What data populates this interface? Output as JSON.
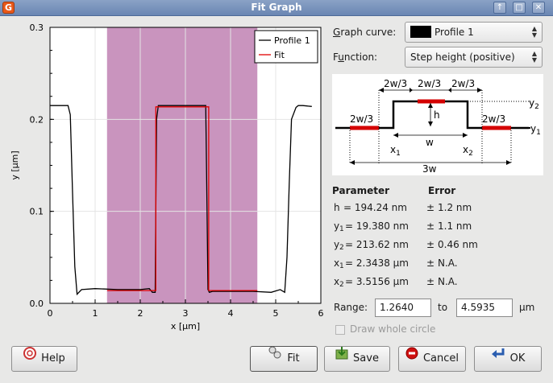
{
  "window": {
    "title": "Fit Graph",
    "app_icon_glyph": "G"
  },
  "window_buttons": {
    "up": "↑",
    "maximize": "□",
    "close": "✕"
  },
  "chart_data": {
    "type": "line",
    "xlabel": "x [µm]",
    "ylabel": "y [µm]",
    "xlim": [
      0,
      6
    ],
    "ylim": [
      0,
      0.3
    ],
    "x_ticks": [
      "0",
      "1",
      "2",
      "3",
      "4",
      "5",
      "6"
    ],
    "y_ticks": [
      "0.0",
      "0.1",
      "0.2",
      "0.3"
    ],
    "highlight_range": [
      1.264,
      4.5935
    ],
    "highlight_color": "#c994be",
    "legend": {
      "position": "top-right",
      "entries": [
        "Profile 1",
        "Fit"
      ]
    },
    "series": [
      {
        "name": "Profile 1",
        "color": "#000000",
        "x": [
          0,
          0.4,
          0.45,
          0.5,
          0.55,
          0.6,
          0.7,
          1.0,
          1.5,
          2.0,
          2.2,
          2.27,
          2.33,
          2.36,
          2.4,
          3.0,
          3.45,
          3.47,
          3.5,
          3.53,
          3.6,
          4.0,
          4.5,
          4.9,
          5.1,
          5.2,
          5.25,
          5.3,
          5.35,
          5.45,
          5.5,
          5.6,
          5.8
        ],
        "y": [
          0.215,
          0.215,
          0.205,
          0.12,
          0.04,
          0.01,
          0.015,
          0.016,
          0.015,
          0.015,
          0.016,
          0.012,
          0.012,
          0.2,
          0.215,
          0.215,
          0.215,
          0.14,
          0.015,
          0.012,
          0.013,
          0.013,
          0.013,
          0.012,
          0.015,
          0.012,
          0.05,
          0.13,
          0.2,
          0.213,
          0.215,
          0.215,
          0.214
        ]
      },
      {
        "name": "Fit",
        "color": "#e00000",
        "x": [
          1.264,
          2.3438,
          2.3438,
          3.5156,
          3.5156,
          4.5935
        ],
        "y": [
          0.0139,
          0.0139,
          0.2136,
          0.2136,
          0.0139,
          0.0139
        ]
      }
    ]
  },
  "controls": {
    "graph_curve_label_pre": "",
    "graph_curve_label_u": "G",
    "graph_curve_label_post": "raph curve:",
    "graph_curve_value": "Profile 1",
    "function_label_pre": "F",
    "function_label_u": "u",
    "function_label_post": "nction:",
    "function_value": "Step height (positive)"
  },
  "diagram": {
    "top_labels": [
      "2w/3",
      "2w/3",
      "2w/3"
    ],
    "left_label": "2w/3",
    "right_label": "2w/3",
    "h": "h",
    "w": "w",
    "three_w": "3w",
    "x1": "x",
    "x1_sub": "1",
    "x2": "x",
    "x2_sub": "2",
    "y1": "y",
    "y1_sub": "1",
    "y2": "y",
    "y2_sub": "2"
  },
  "params": {
    "header_parameter": "Parameter",
    "header_error": "Error",
    "rows": [
      {
        "name": "h",
        "sub": "",
        "value": "= 194.24 nm",
        "pm": "±",
        "error": "1.2 nm"
      },
      {
        "name": "y",
        "sub": "1",
        "value": "= 19.380 nm",
        "pm": "±",
        "error": "1.1 nm"
      },
      {
        "name": "y",
        "sub": "2",
        "value": "= 213.62 nm",
        "pm": "±",
        "error": "0.46 nm"
      },
      {
        "name": "x",
        "sub": "1",
        "value": "= 2.3438 µm",
        "pm": "±",
        "error": "N.A."
      },
      {
        "name": "x",
        "sub": "2",
        "value": "= 3.5156 µm",
        "pm": "±",
        "error": "N.A."
      }
    ]
  },
  "range": {
    "label": "Range:",
    "from": "1.2640",
    "to_label": "to",
    "to": "4.5935",
    "unit": "µm"
  },
  "draw_whole_circle": {
    "label": "Draw whole circle",
    "checked": false,
    "enabled": false
  },
  "buttons": {
    "help": "Help",
    "fit": "Fit",
    "save": "Save",
    "cancel": "Cancel",
    "ok": "OK"
  }
}
